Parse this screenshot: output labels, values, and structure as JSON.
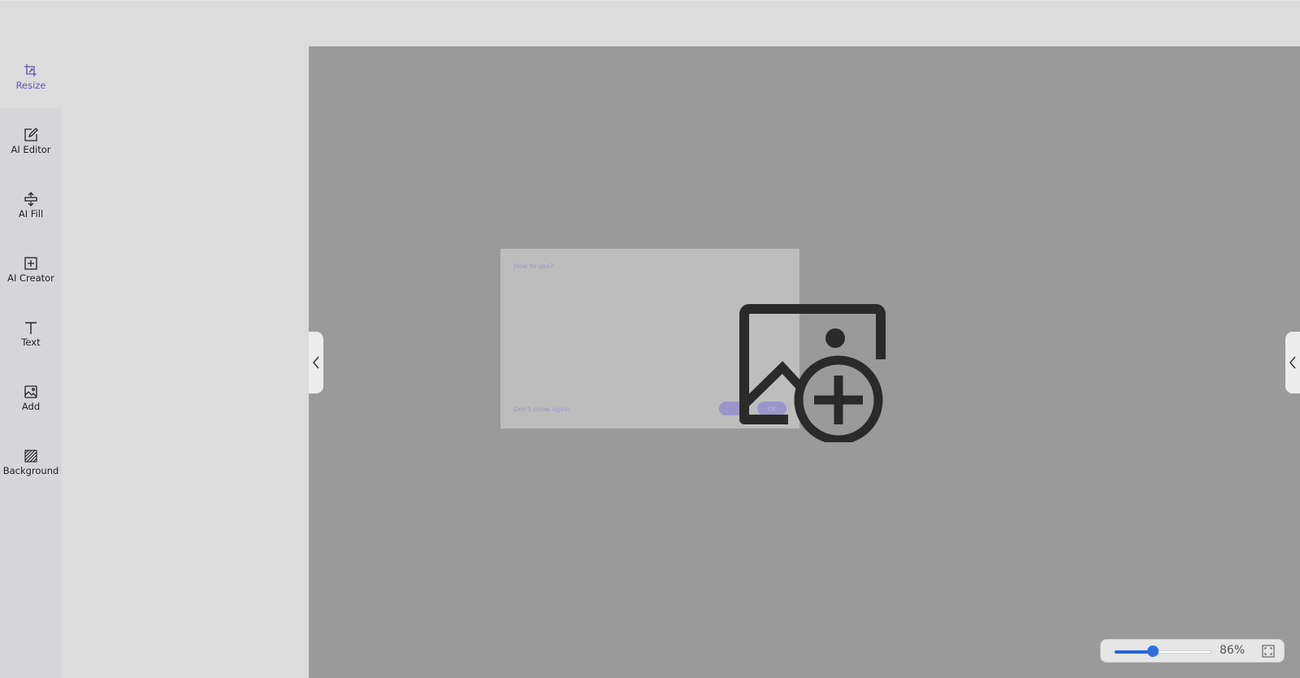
{
  "sidebar": {
    "items": [
      {
        "label": "Resize",
        "icon": "crop-icon",
        "active": true
      },
      {
        "label": "AI Editor",
        "icon": "edit-square-icon",
        "active": false
      },
      {
        "label": "AI Fill",
        "icon": "expand-vertical-icon",
        "active": false
      },
      {
        "label": "AI Creator",
        "icon": "plus-square-icon",
        "active": false
      },
      {
        "label": "Text",
        "icon": "text-icon",
        "active": false
      },
      {
        "label": "Add",
        "icon": "image-icon",
        "active": false
      },
      {
        "label": "Background",
        "icon": "hatch-pattern-icon",
        "active": false
      }
    ]
  },
  "dialog": {
    "title": "How to use?",
    "dont_show": "Don't show again",
    "cancel_label": "",
    "ok_label": "OK"
  },
  "zoom": {
    "percent_label": "86%",
    "level": 0.4
  },
  "colors": {
    "accent": "#5a54b5",
    "slider": "#2563d8",
    "canvas": "#9a9a9a"
  }
}
